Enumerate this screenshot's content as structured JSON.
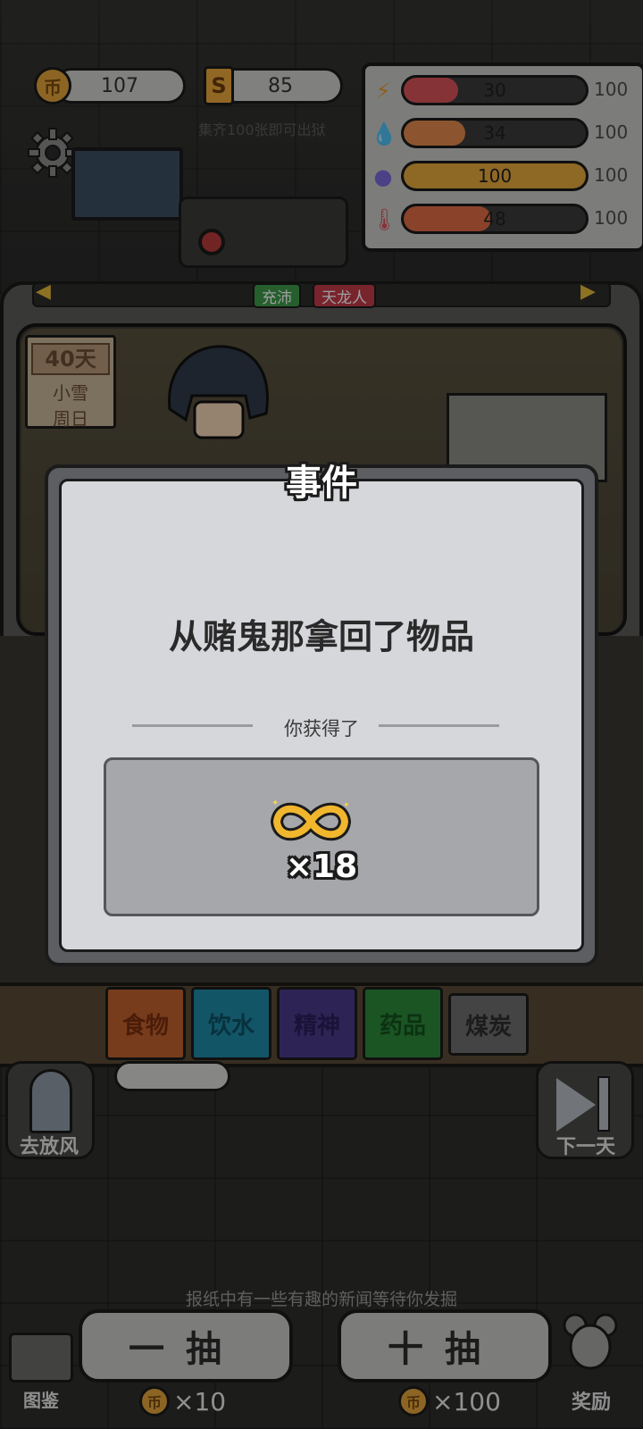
{
  "currency": {
    "coins": "107",
    "cards": "85",
    "coin_symbol": "币",
    "card_symbol": "S"
  },
  "hint": "集齐100张即可出狱",
  "stats": [
    {
      "icon": "energy-icon",
      "value": "30",
      "max": "100",
      "fill_pct": 30,
      "color": "#d8535a"
    },
    {
      "icon": "water-icon",
      "value": "34",
      "max": "100",
      "fill_pct": 34,
      "color": "#e28a4c"
    },
    {
      "icon": "brain-icon",
      "value": "100",
      "max": "100",
      "fill_pct": 100,
      "color": "#e6a93d"
    },
    {
      "icon": "thermometer-icon",
      "value": "48",
      "max": "100",
      "fill_pct": 48,
      "color": "#e06b45"
    }
  ],
  "tags": [
    "充沛",
    "天龙人"
  ],
  "day": {
    "count": "40天",
    "weather": "小雪",
    "weekday": "周日"
  },
  "modal": {
    "title": "事件",
    "message": "从赌鬼那拿回了物品",
    "reward_label": "你获得了",
    "reward_count": "×18"
  },
  "resource_tabs": [
    {
      "label": "食物",
      "bg": "#c0612c",
      "fg": "#7a2f10"
    },
    {
      "label": "饮水",
      "bg": "#1d8aa6",
      "fg": "#0e4f63"
    },
    {
      "label": "精神",
      "bg": "#4a3a8a",
      "fg": "#2a1f5a"
    },
    {
      "label": "药品",
      "bg": "#2d8a3a",
      "fg": "#14511d"
    },
    {
      "label": "煤炭",
      "bg": "#6f6f6f",
      "fg": "#2e2e2e"
    }
  ],
  "side": {
    "left_label": "去放风",
    "right_label": "下一天"
  },
  "news_tip": "报纸中有一些有趣的新闻等待你发掘",
  "gacha": {
    "single_label": "一抽",
    "single_cost": "×10",
    "ten_label": "十抽",
    "ten_cost": "×100"
  },
  "bottom": {
    "book_label": "图鉴",
    "reward_label": "奖励"
  }
}
